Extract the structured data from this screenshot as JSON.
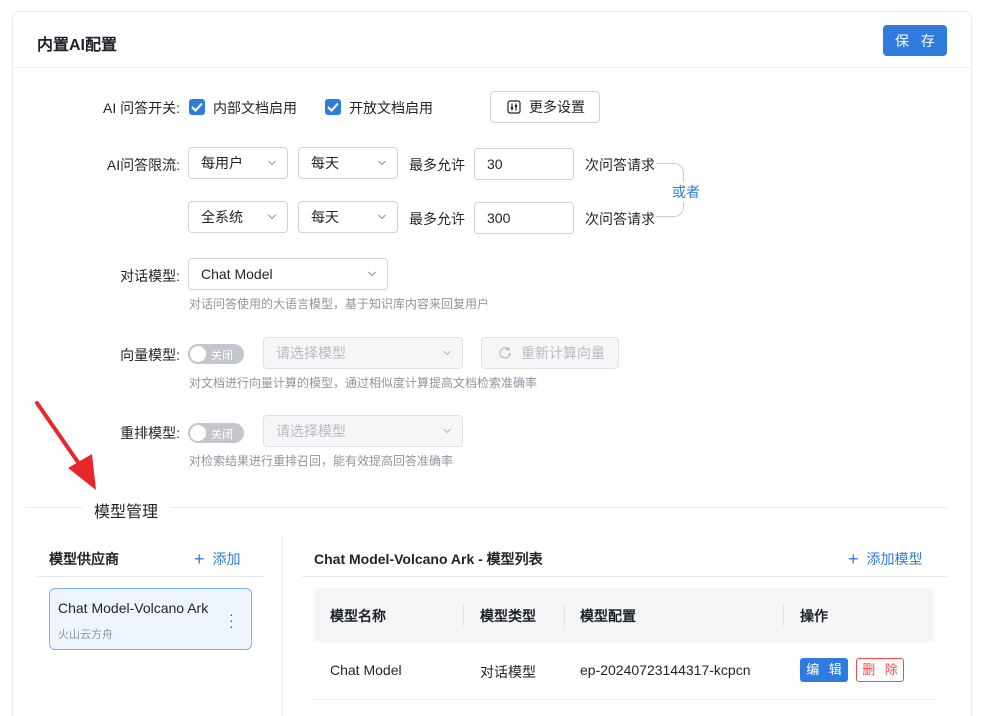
{
  "header": {
    "title": "内置AI配置",
    "save_label": "保 存"
  },
  "ai_switch": {
    "label": "AI 问答开关:",
    "options": [
      {
        "label": "内部文档启用",
        "checked": true
      },
      {
        "label": "开放文档启用",
        "checked": true
      }
    ],
    "more_settings_label": "更多设置"
  },
  "rate_limit": {
    "label": "AI问答限流:",
    "rows": [
      {
        "scope": "每用户",
        "period": "每天",
        "max_label": "最多允许",
        "value": "30",
        "suffix": "次问答请求"
      },
      {
        "scope": "全系统",
        "period": "每天",
        "max_label": "最多允许",
        "value": "300",
        "suffix": "次问答请求"
      }
    ],
    "or_label": "或者"
  },
  "chat_model": {
    "label": "对话模型:",
    "selected": "Chat Model",
    "hint": "对话问答使用的大语言模型，基于知识库内容来回复用户"
  },
  "vector_model": {
    "label": "向量模型:",
    "toggle_label": "关闭",
    "placeholder": "请选择模型",
    "recalc_label": "重新计算向量",
    "hint": "对文档进行向量计算的模型，通过相似度计算提高文档检索准确率"
  },
  "rerank_model": {
    "label": "重排模型:",
    "toggle_label": "关闭",
    "placeholder": "请选择模型",
    "hint": "对检索结果进行重排召回，能有效提高回答准确率"
  },
  "model_management": {
    "title": "模型管理",
    "providers": {
      "title": "模型供应商",
      "add_label": "添加",
      "items": [
        {
          "name": "Chat Model-Volcano Ark",
          "sub": "火山云方舟"
        }
      ]
    },
    "model_list": {
      "title": "Chat Model-Volcano Ark - 模型列表",
      "add_label": "添加模型",
      "columns": [
        "模型名称",
        "模型类型",
        "模型配置",
        "操作"
      ],
      "rows": [
        {
          "name": "Chat Model",
          "type": "对话模型",
          "config": "ep-20240723144317-kcpcn",
          "edit_label": "编 辑",
          "delete_label": "删 除"
        }
      ]
    }
  },
  "colors": {
    "primary": "#2f7bde",
    "danger": "#f54a45",
    "annotation_arrow": "#e8262c"
  }
}
